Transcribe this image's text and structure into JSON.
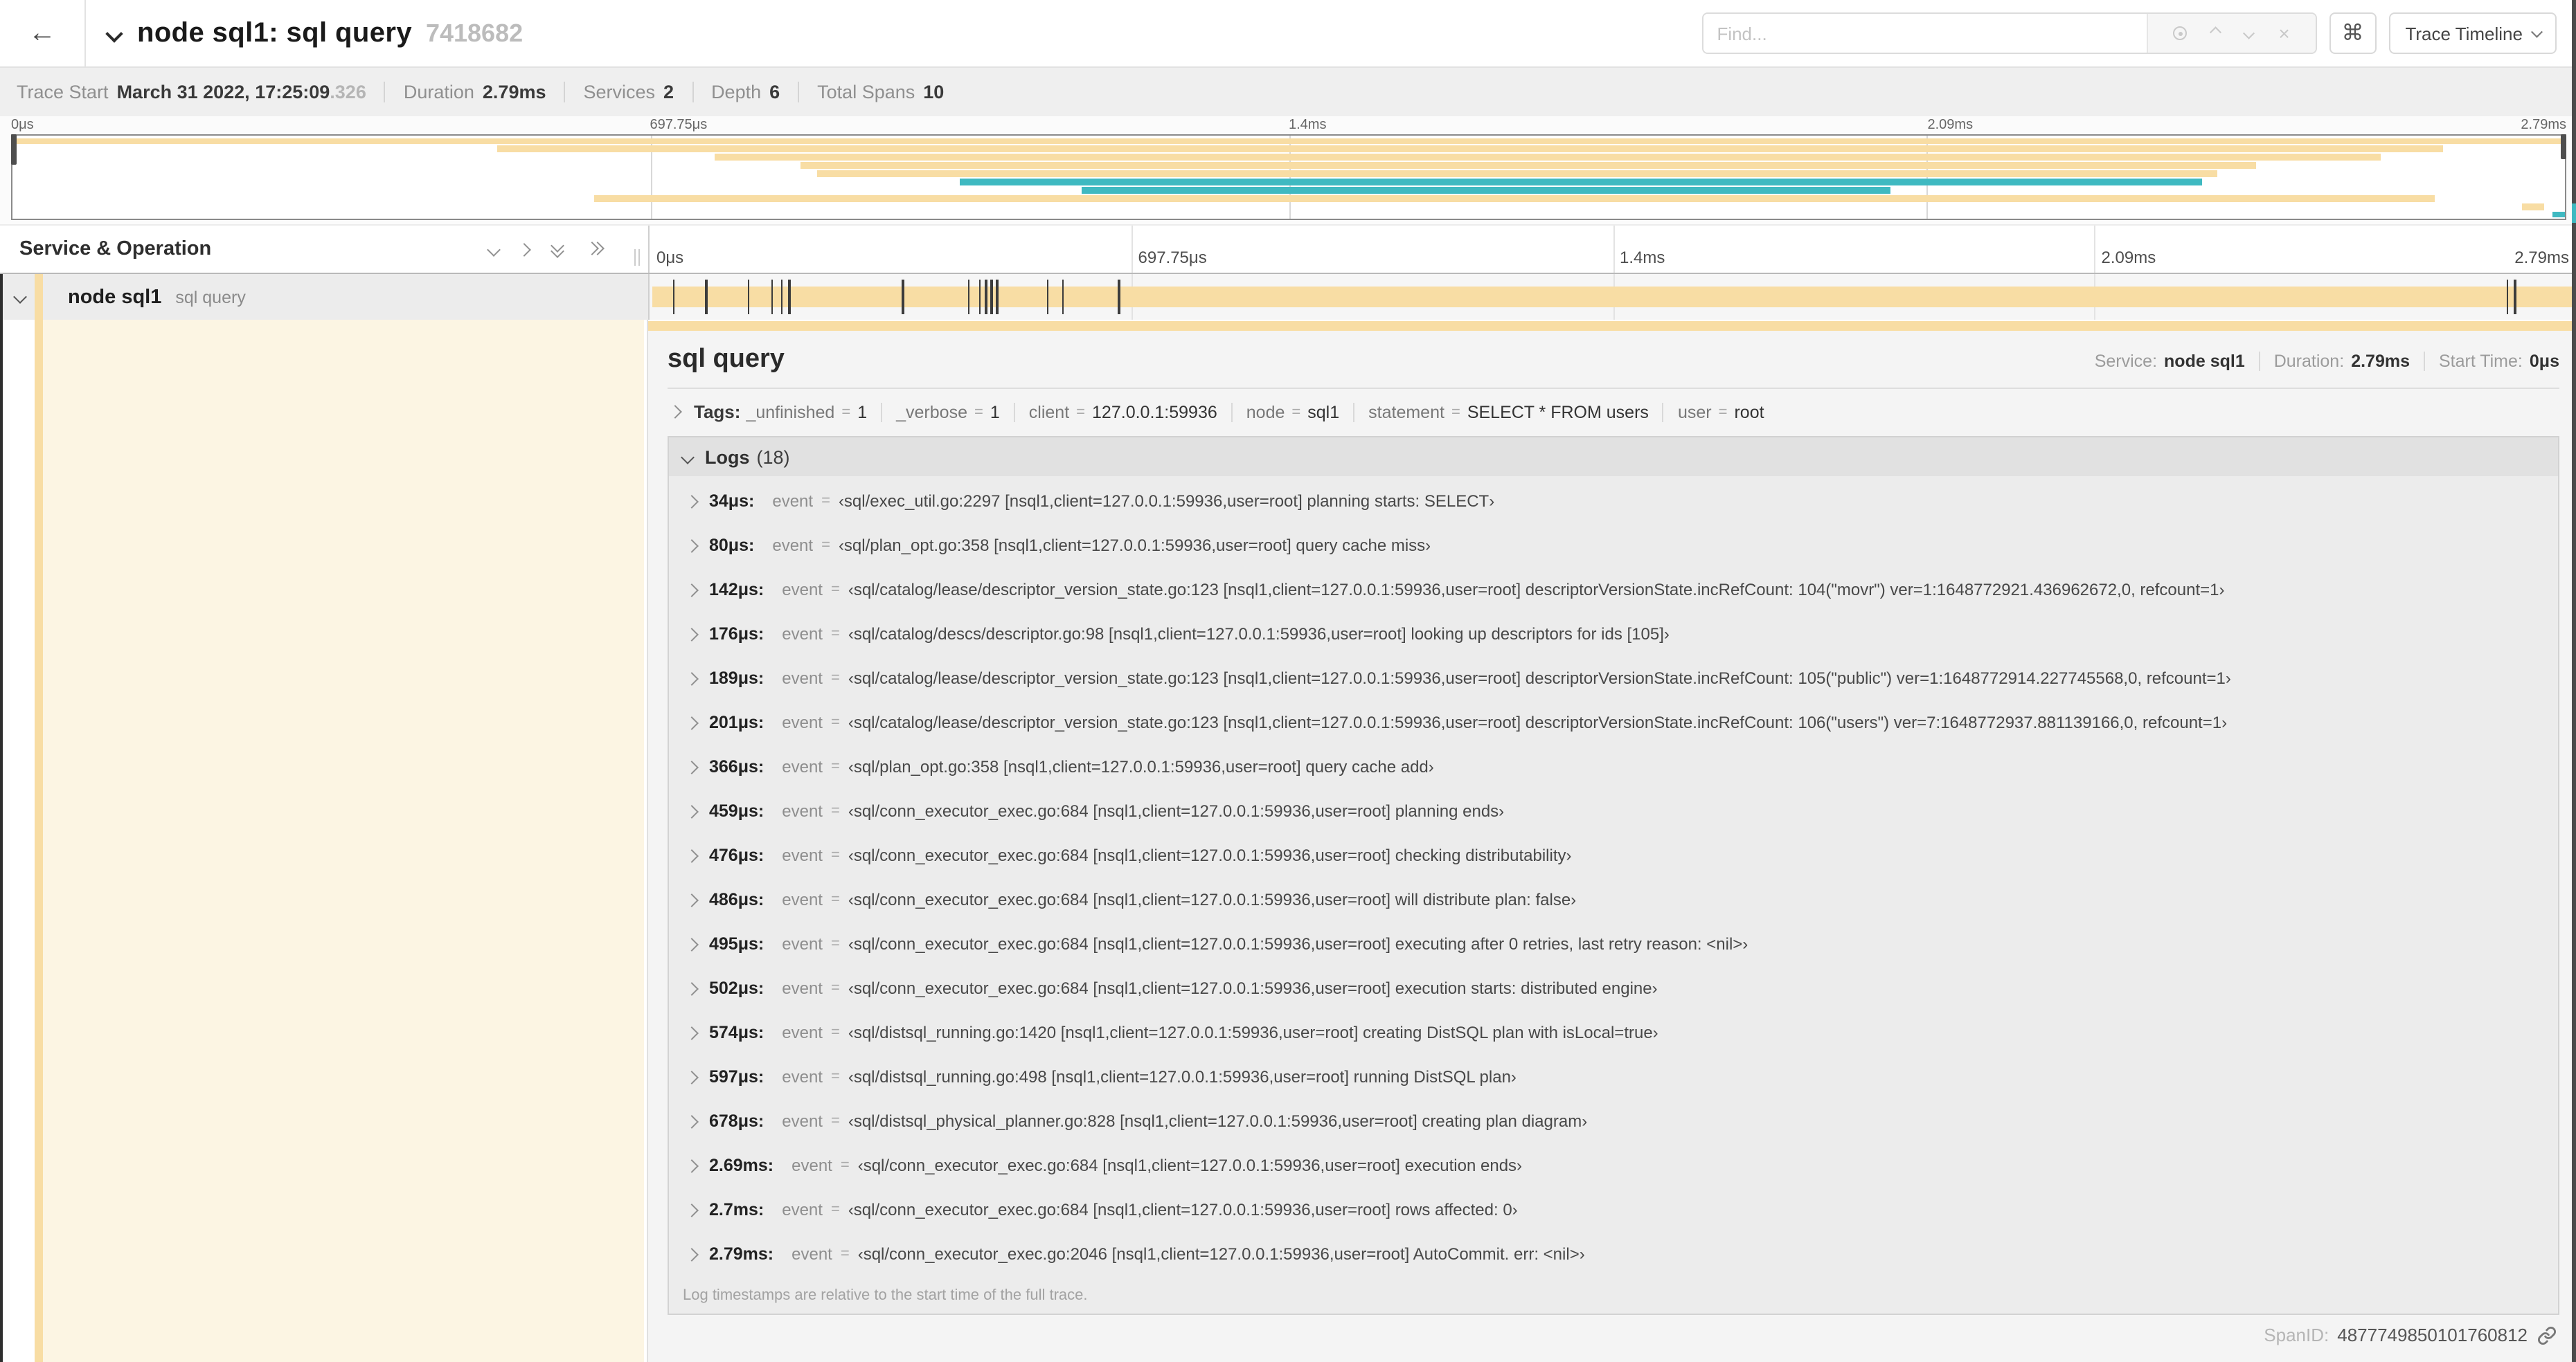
{
  "colors": {
    "tan": "#f8dda4",
    "teal": "#3fb9c1",
    "cream": "#fcf5e3"
  },
  "header": {
    "back_icon": "←",
    "title": "node sql1: sql query",
    "trace_id": "7418682",
    "find_placeholder": "Find...",
    "shortcut_button": "⌘",
    "view_button": "Trace Timeline"
  },
  "summary": {
    "items": [
      {
        "label": "Trace Start",
        "value": "March 31 2022, 17:25:09",
        "suffix": ".326"
      },
      {
        "label": "Duration",
        "value": "2.79ms"
      },
      {
        "label": "Services",
        "value": "2"
      },
      {
        "label": "Depth",
        "value": "6"
      },
      {
        "label": "Total Spans",
        "value": "10"
      }
    ]
  },
  "ruler_labels": [
    "0μs",
    "697.75μs",
    "1.4ms",
    "2.09ms",
    "2.79ms"
  ],
  "minimap": {
    "spans": [
      {
        "start": 0,
        "end": 100,
        "color": "tan"
      },
      {
        "start": 19,
        "end": 95.2,
        "color": "tan"
      },
      {
        "start": 27.5,
        "end": 92.8,
        "color": "tan"
      },
      {
        "start": 30.9,
        "end": 87.9,
        "color": "tan"
      },
      {
        "start": 31.5,
        "end": 86.4,
        "color": "tan"
      },
      {
        "start": 37.1,
        "end": 85.8,
        "color": "teal"
      },
      {
        "start": 41.9,
        "end": 73.6,
        "color": "teal"
      },
      {
        "start": 22.8,
        "end": 94.9,
        "color": "tan"
      },
      {
        "start": 98.3,
        "end": 99.2,
        "color": "tan"
      },
      {
        "start": 99.5,
        "end": 100,
        "color": "teal"
      }
    ]
  },
  "timeline_header": {
    "column_title": "Service & Operation"
  },
  "span_row": {
    "service": "node sql1",
    "operation": "sql query",
    "ticks_pct": [
      1.2,
      2.9,
      5.1,
      6.3,
      6.8,
      7.2,
      13.1,
      16.5,
      17.1,
      17.4,
      17.7,
      18,
      20.6,
      21.4,
      24.3,
      96.4,
      96.8,
      99.8
    ]
  },
  "detail": {
    "title": "sql query",
    "meta": [
      {
        "label": "Service:",
        "value": "node sql1"
      },
      {
        "label": "Duration:",
        "value": "2.79ms"
      },
      {
        "label": "Start Time:",
        "value": "0μs"
      }
    ],
    "tags_label": "Tags:",
    "tags_eq": "=",
    "tags": [
      {
        "key": "_unfinished",
        "value": "1"
      },
      {
        "key": "_verbose",
        "value": "1"
      },
      {
        "key": "client",
        "value": "127.0.0.1:59936"
      },
      {
        "key": "node",
        "value": "sql1"
      },
      {
        "key": "statement",
        "value": "SELECT * FROM users"
      },
      {
        "key": "user",
        "value": "root"
      }
    ],
    "logs": {
      "title": "Logs",
      "count": "(18)",
      "key": "event",
      "eq": "=",
      "entries": [
        {
          "t": "34μs:",
          "v": "‹sql/exec_util.go:2297 [nsql1,client=127.0.0.1:59936,user=root] planning starts: SELECT›"
        },
        {
          "t": "80μs:",
          "v": "‹sql/plan_opt.go:358 [nsql1,client=127.0.0.1:59936,user=root] query cache miss›"
        },
        {
          "t": "142μs:",
          "v": "‹sql/catalog/lease/descriptor_version_state.go:123 [nsql1,client=127.0.0.1:59936,user=root] descriptorVersionState.incRefCount: 104(\"movr\") ver=1:1648772921.436962672,0, refcount=1›"
        },
        {
          "t": "176μs:",
          "v": "‹sql/catalog/descs/descriptor.go:98 [nsql1,client=127.0.0.1:59936,user=root] looking up descriptors for ids [105]›"
        },
        {
          "t": "189μs:",
          "v": "‹sql/catalog/lease/descriptor_version_state.go:123 [nsql1,client=127.0.0.1:59936,user=root] descriptorVersionState.incRefCount: 105(\"public\") ver=1:1648772914.227745568,0, refcount=1›"
        },
        {
          "t": "201μs:",
          "v": "‹sql/catalog/lease/descriptor_version_state.go:123 [nsql1,client=127.0.0.1:59936,user=root] descriptorVersionState.incRefCount: 106(\"users\") ver=7:1648772937.881139166,0, refcount=1›"
        },
        {
          "t": "366μs:",
          "v": "‹sql/plan_opt.go:358 [nsql1,client=127.0.0.1:59936,user=root] query cache add›"
        },
        {
          "t": "459μs:",
          "v": "‹sql/conn_executor_exec.go:684 [nsql1,client=127.0.0.1:59936,user=root] planning ends›"
        },
        {
          "t": "476μs:",
          "v": "‹sql/conn_executor_exec.go:684 [nsql1,client=127.0.0.1:59936,user=root] checking distributability›"
        },
        {
          "t": "486μs:",
          "v": "‹sql/conn_executor_exec.go:684 [nsql1,client=127.0.0.1:59936,user=root] will distribute plan: false›"
        },
        {
          "t": "495μs:",
          "v": "‹sql/conn_executor_exec.go:684 [nsql1,client=127.0.0.1:59936,user=root] executing after 0 retries, last retry reason: <nil>›"
        },
        {
          "t": "502μs:",
          "v": "‹sql/conn_executor_exec.go:684 [nsql1,client=127.0.0.1:59936,user=root] execution starts: distributed engine›"
        },
        {
          "t": "574μs:",
          "v": "‹sql/distsql_running.go:1420 [nsql1,client=127.0.0.1:59936,user=root] creating DistSQL plan with isLocal=true›"
        },
        {
          "t": "597μs:",
          "v": "‹sql/distsql_running.go:498 [nsql1,client=127.0.0.1:59936,user=root] running DistSQL plan›"
        },
        {
          "t": "678μs:",
          "v": "‹sql/distsql_physical_planner.go:828 [nsql1,client=127.0.0.1:59936,user=root] creating plan diagram›"
        },
        {
          "t": "2.69ms:",
          "v": "‹sql/conn_executor_exec.go:684 [nsql1,client=127.0.0.1:59936,user=root] execution ends›"
        },
        {
          "t": "2.7ms:",
          "v": "‹sql/conn_executor_exec.go:684 [nsql1,client=127.0.0.1:59936,user=root] rows affected: 0›"
        },
        {
          "t": "2.79ms:",
          "v": "‹sql/conn_executor_exec.go:2046 [nsql1,client=127.0.0.1:59936,user=root] AutoCommit. err: <nil>›"
        }
      ],
      "footnote": "Log timestamps are relative to the start time of the full trace."
    },
    "span_id_label": "SpanID:",
    "span_id": "4877749850101760812"
  }
}
